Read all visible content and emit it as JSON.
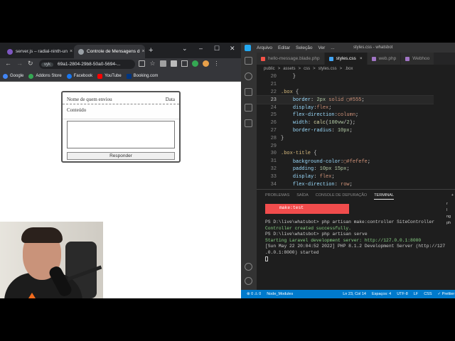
{
  "browser": {
    "tabs": [
      {
        "label": "server.js – radial-ninth-un",
        "close": "×",
        "color": "#7e57c2"
      },
      {
        "label": "Controle de Mensagens d",
        "close": "×",
        "color": "#9aa0a6"
      }
    ],
    "new_tab": "+",
    "window_controls": [
      "⌄",
      "–",
      "☐",
      "✕"
    ],
    "nav": {
      "back": "←",
      "forward": "→",
      "reload": "↻"
    },
    "address": {
      "security_chip": "vyk",
      "url": "69a1-2804-29b8-50a0-5694-..."
    },
    "bookmarks": [
      {
        "label": "Google",
        "color": "#4285f4"
      },
      {
        "label": "Addons Store",
        "color": "#34a853"
      },
      {
        "label": "Facebook",
        "color": "#1877f2"
      },
      {
        "label": "YouTube",
        "color": "#ff0000"
      },
      {
        "label": "Booking.com",
        "color": "#003580"
      }
    ]
  },
  "message_box": {
    "sender_placeholder": "Nome de quem enviou",
    "date_label": "Data",
    "content_label": "Conteúdo",
    "reply_button": "Responder"
  },
  "vscode": {
    "menu": [
      "Arquivo",
      "Editar",
      "Seleção",
      "Ver",
      "..."
    ],
    "window_title": "styles.css - whatsbot",
    "tabs": [
      {
        "label": "hello-message.blade.php",
        "color": "#f55247",
        "active": false
      },
      {
        "label": "styles.css",
        "color": "#42a5f5",
        "active": true,
        "close": "×"
      },
      {
        "label": "web.php",
        "color": "#a074c4",
        "active": false
      },
      {
        "label": "Webhoo",
        "color": "#a074c4",
        "active": false
      }
    ],
    "breadcrumb": [
      "public",
      ">",
      "assets",
      ">",
      "css",
      ">",
      "styles.css",
      ">",
      ".box"
    ],
    "code_lines": [
      {
        "n": "20",
        "html": "<span class='pun'>    }</span>"
      },
      {
        "n": "21",
        "html": ""
      },
      {
        "n": "22",
        "html": "<span class='sel'>.box</span> <span class='pun'>{</span>"
      },
      {
        "n": "23",
        "html": "    <span class='prop'>border</span><span class='pun'>: </span><span class='num'>2px</span> <span class='val'>solid</span> <span class='val'>▢#555</span><span class='pun'>;</span>",
        "current": true
      },
      {
        "n": "24",
        "html": "    <span class='prop'>display</span><span class='pun'>:</span><span class='val'>flex</span><span class='pun'>;</span>"
      },
      {
        "n": "25",
        "html": "    <span class='prop'>flex-direction</span><span class='pun'>:</span><span class='val'>column</span><span class='pun'>;</span>"
      },
      {
        "n": "26",
        "html": "    <span class='prop'>width</span><span class='pun'>: </span><span class='fn'>calc</span><span class='pun'>(</span><span class='num'>100vw</span><span class='pun'>/</span><span class='num'>2</span><span class='pun'>);</span>"
      },
      {
        "n": "27",
        "html": "    <span class='prop'>border-radius</span><span class='pun'>: </span><span class='num'>10px</span><span class='pun'>;</span>"
      },
      {
        "n": "28",
        "html": "<span class='pun'>}</span>"
      },
      {
        "n": "29",
        "html": ""
      },
      {
        "n": "30",
        "html": "<span class='sel'>.box-title</span> <span class='pun'>{</span>"
      },
      {
        "n": "31",
        "html": "    <span class='prop'>background-color</span><span class='pun'>:</span><span class='val'>▢#fefefe</span><span class='pun'>;</span>"
      },
      {
        "n": "32",
        "html": "    <span class='prop'>padding</span><span class='pun'>: </span><span class='num'>10px 15px</span><span class='pun'>;</span>"
      },
      {
        "n": "33",
        "html": "    <span class='prop'>display</span><span class='pun'>: </span><span class='val'>flex</span><span class='pun'>;</span>"
      },
      {
        "n": "34",
        "html": "    <span class='prop'>flex-direction</span><span class='pun'>: </span><span class='val'>row</span><span class='pun'>;</span>"
      }
    ],
    "panel_tabs": [
      "PROBLEMAS",
      "SAÍDA",
      "CONSOLE DE DEPURAÇÃO",
      "TERMINAL"
    ],
    "panel_add": "+",
    "terminal": {
      "highlight": "make:test",
      "lines": [
        {
          "text": "PS D:\\live\\whatsbot> php artisan make:controller SiteController",
          "cls": ""
        },
        {
          "text": "Controller created successfully.",
          "cls": "ok"
        },
        {
          "text": "PS D:\\live\\whatsbot> php artisan serve",
          "cls": ""
        },
        {
          "text": "Starting Laravel development server: http://127.0.0.1:8000",
          "cls": "st"
        },
        {
          "text": "[Sun May 22 20:04:52 2022] PHP 8.1.2 Development Server (http://127",
          "cls": ""
        },
        {
          "text": ".0.0.1:8000) started",
          "cls": ""
        }
      ],
      "side_list": [
        "r",
        "l",
        "ng",
        "ph"
      ]
    },
    "status": {
      "errors": "⊗ 0 ⚠ 0",
      "node": "Node_Modules",
      "position": "Ln 23, Col 14",
      "spaces": "Espaços: 4",
      "encoding": "UTF-8",
      "eol": "LF",
      "lang": "CSS",
      "prettier": "✓ Prettier"
    }
  }
}
